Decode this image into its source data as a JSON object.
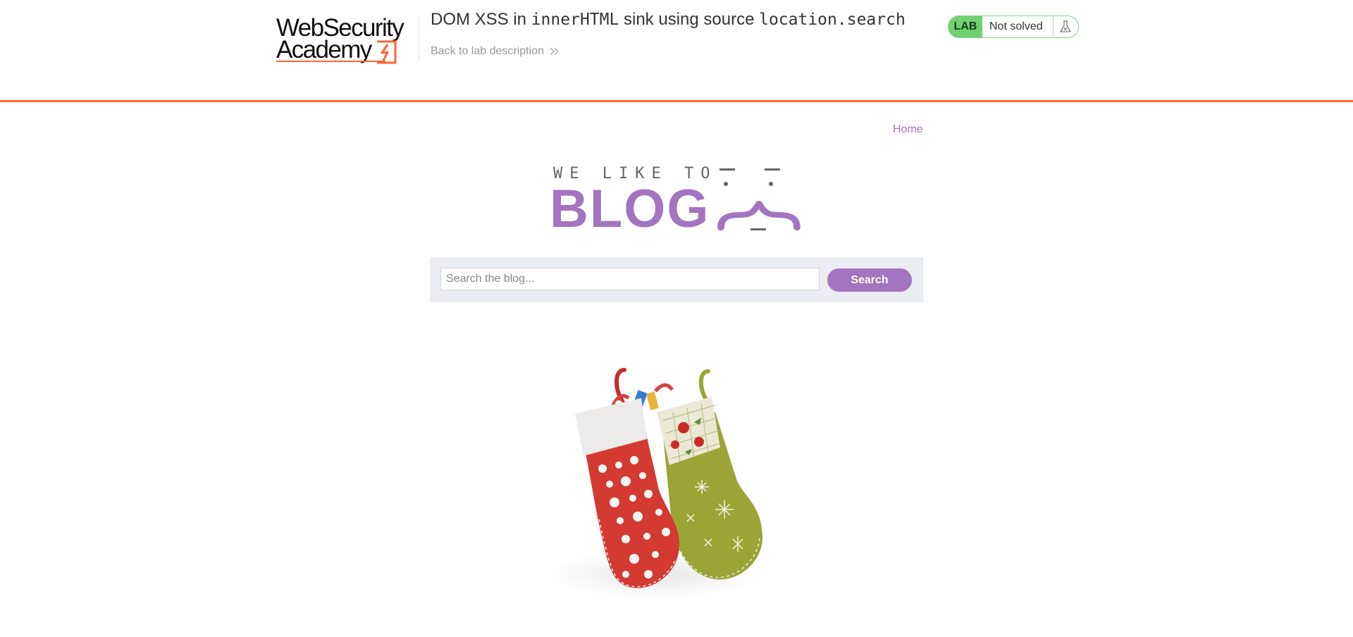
{
  "academy": {
    "logo_line1": "WebSecurity",
    "logo_line2": "Academy",
    "lab_title_prefix": "DOM XSS in ",
    "lab_title_code1": "innerHTML",
    "lab_title_middle": " sink using source ",
    "lab_title_code2": "location.search",
    "back_link": "Back to lab description",
    "lab_badge": "LAB",
    "lab_status": "Not solved",
    "accent_color": "#ff6633",
    "solved_badge_color": "#70d16f"
  },
  "blog": {
    "nav_home": "Home",
    "tagline": "WE LIKE TO",
    "brand_word": "BLOG",
    "brand_color": "#a374bf",
    "search": {
      "placeholder": "Search the blog...",
      "value": "",
      "button_label": "Search"
    },
    "post_image_icon": "christmas-stockings-image"
  }
}
